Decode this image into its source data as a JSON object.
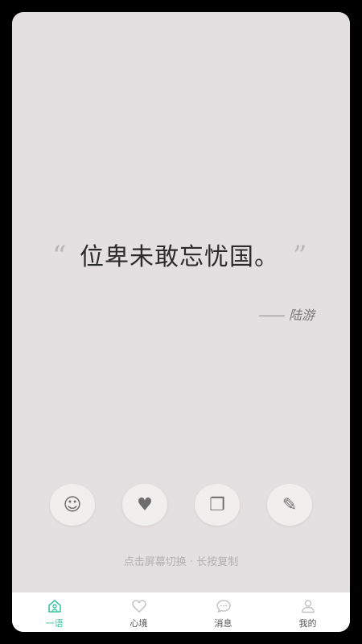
{
  "quote": {
    "open_mark": "“",
    "text": "位卑未敢忘忧国。",
    "close_mark": "”",
    "author": "陆游"
  },
  "actions": [
    {
      "icon": "smile-icon",
      "glyph": "☺"
    },
    {
      "icon": "heart-icon",
      "glyph": "♥"
    },
    {
      "icon": "copy-icon",
      "glyph": "❐"
    },
    {
      "icon": "pencil-icon",
      "glyph": "✎"
    }
  ],
  "hint": "点击屏幕切换 · 长按复制",
  "tabs": [
    {
      "label": "一语",
      "icon": "home-icon",
      "active": true
    },
    {
      "label": "心境",
      "icon": "heart-outline-icon",
      "active": false
    },
    {
      "label": "消息",
      "icon": "message-icon",
      "active": false
    },
    {
      "label": "我的",
      "icon": "user-icon",
      "active": false
    }
  ],
  "colors": {
    "background": "#e4dfe0",
    "accent": "#3dc5a6",
    "tab_inactive": "#555555"
  }
}
